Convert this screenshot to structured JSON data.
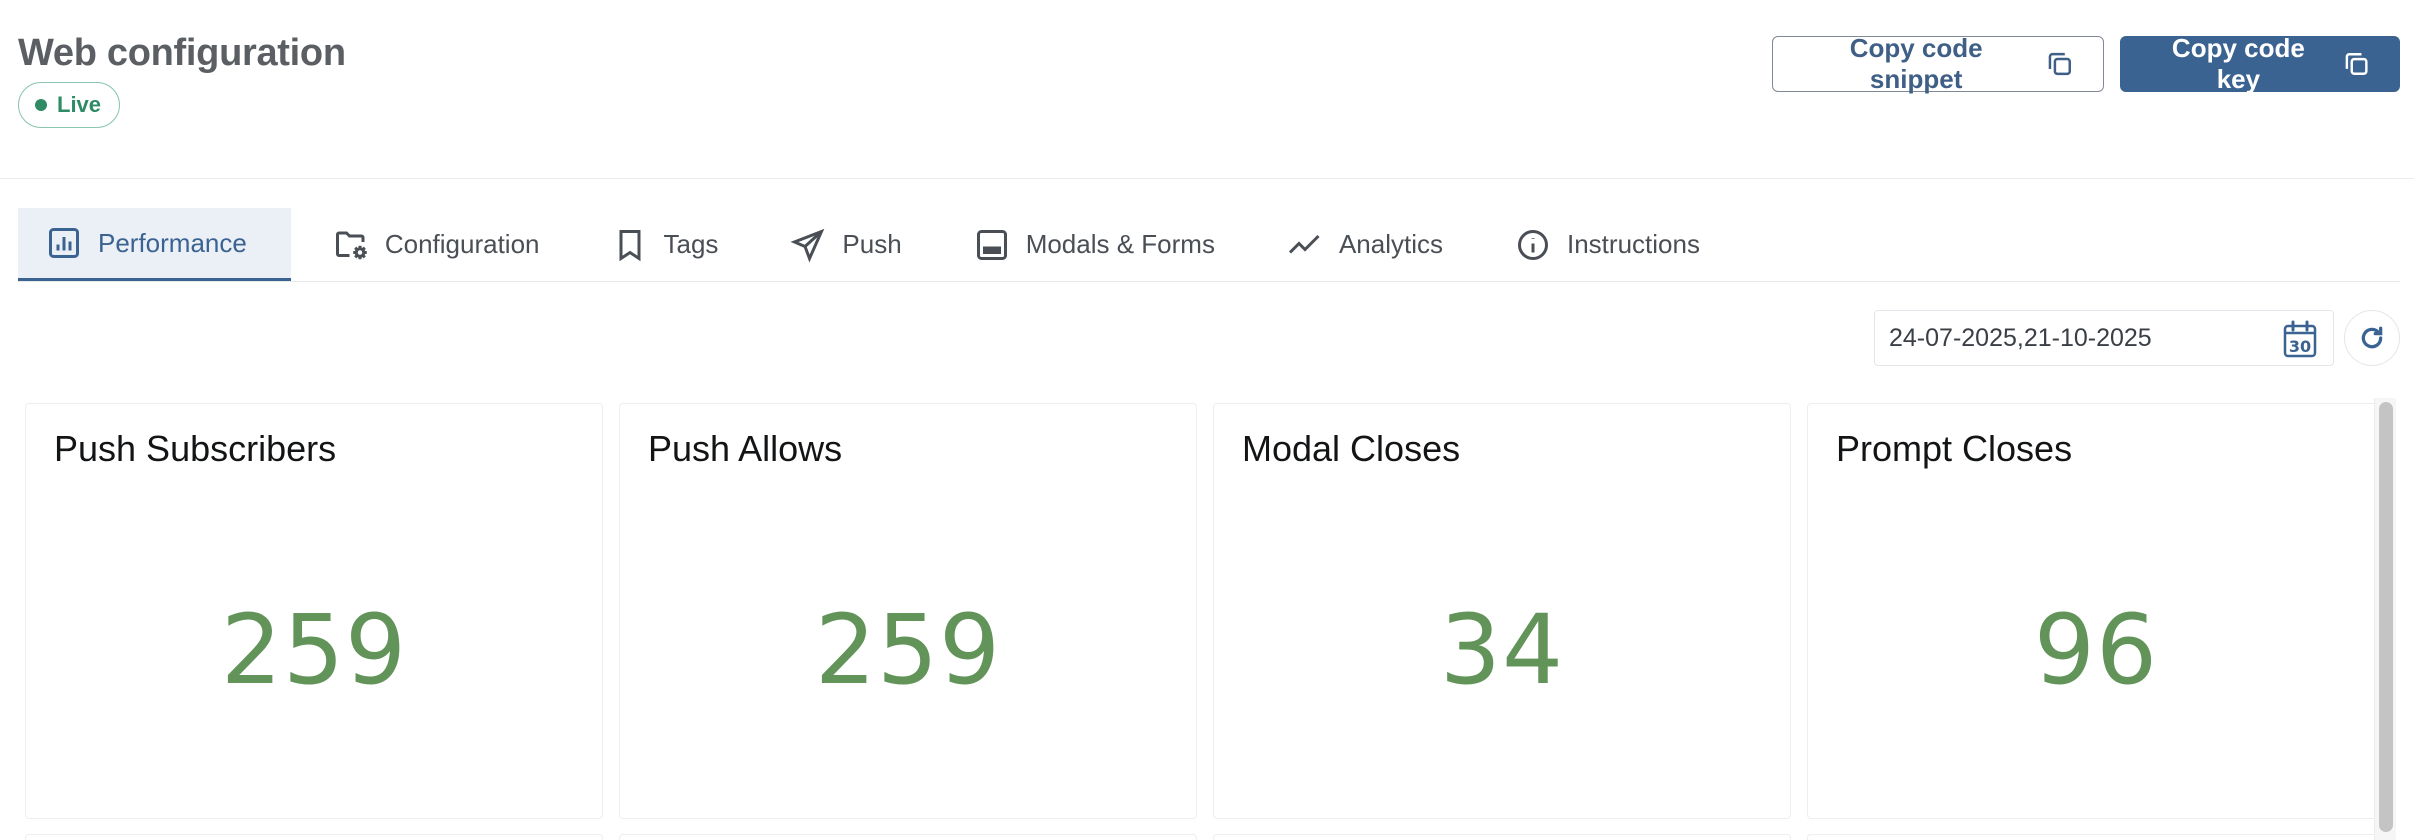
{
  "header": {
    "title": "Web configuration",
    "status_badge": "Live",
    "status_color": "#2e8b66"
  },
  "actions": {
    "copy_snippet_label": "Copy code snippet",
    "copy_key_label": "Copy code key"
  },
  "tabs": [
    {
      "label": "Performance",
      "icon": "bar-chart-icon",
      "active": true
    },
    {
      "label": "Configuration",
      "icon": "folder-gear-icon",
      "active": false
    },
    {
      "label": "Tags",
      "icon": "bookmark-icon",
      "active": false
    },
    {
      "label": "Push",
      "icon": "send-icon",
      "active": false
    },
    {
      "label": "Modals & Forms",
      "icon": "modal-icon",
      "active": false
    },
    {
      "label": "Analytics",
      "icon": "trend-line-icon",
      "active": false
    },
    {
      "label": "Instructions",
      "icon": "info-icon",
      "active": false
    }
  ],
  "date_range": {
    "value": "24-07-2025,21-10-2025",
    "calendar_day": "30"
  },
  "cards": [
    {
      "title": "Push Subscribers",
      "value": "259"
    },
    {
      "title": "Push Allows",
      "value": "259"
    },
    {
      "title": "Modal Closes",
      "value": "34"
    },
    {
      "title": "Prompt Closes",
      "value": "96"
    }
  ],
  "colors": {
    "accent": "#3b6391",
    "metric_value": "#62945a"
  }
}
